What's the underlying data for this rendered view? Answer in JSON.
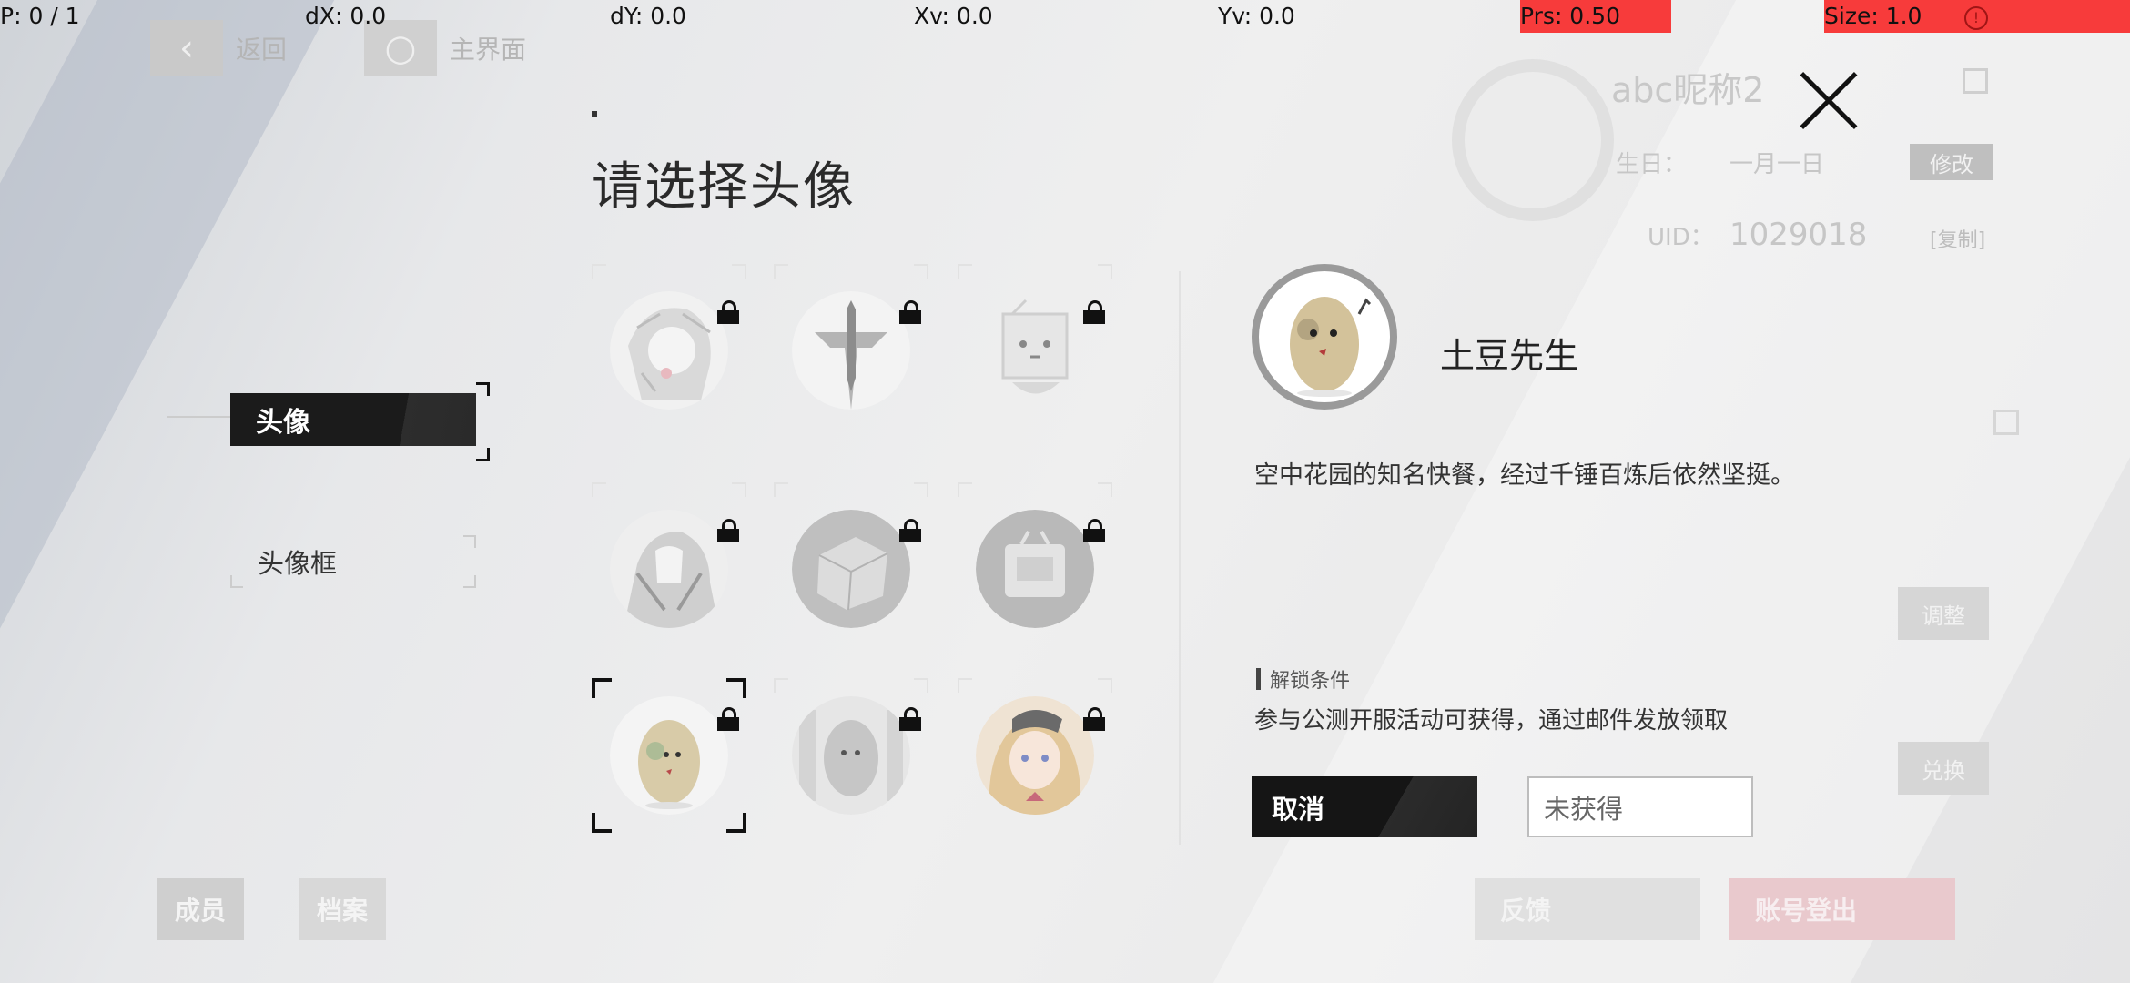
{
  "debug": {
    "pointer": "P: 0 / 1",
    "dx": "dX: 0.0",
    "dy": "dY: 0.0",
    "xv": "Xv: 0.0",
    "yv": "Yv: 0.0",
    "prs": "Prs: 0.50",
    "size": "Size: 1.0"
  },
  "background": {
    "back_label": "返回",
    "home_label": "主界面",
    "nickname": "abc昵称2",
    "birthday_label": "生日：",
    "birthday_value": "一月一日",
    "modify_label": "修改",
    "uid_label": "UID：",
    "uid_value": "1029018",
    "copy_label": "[复制]",
    "side_btn_1": "调整",
    "side_btn_2": "兑换",
    "bottom_left_1": "成员",
    "bottom_left_2": "档案",
    "bottom_right_1": "反馈",
    "bottom_right_2": "账号登出"
  },
  "tabs": [
    {
      "label": "头像",
      "active": true
    },
    {
      "label": "头像框",
      "active": false
    }
  ],
  "dialog": {
    "title": "请选择头像",
    "avatars": [
      {
        "icon": "girl-sketch-avatar",
        "locked": true
      },
      {
        "icon": "emblem-logo-avatar",
        "locked": true
      },
      {
        "icon": "tv-robot-avatar",
        "locked": true
      },
      {
        "icon": "hooded-girl-avatar",
        "locked": true
      },
      {
        "icon": "gray-cube-avatar",
        "locked": true
      },
      {
        "icon": "gray-tv-avatar",
        "locked": true
      },
      {
        "icon": "potato-avatar",
        "locked": true,
        "selected": true
      },
      {
        "icon": "gray-potato-avatar",
        "locked": true
      },
      {
        "icon": "blonde-girl-avatar",
        "locked": true
      }
    ],
    "detail": {
      "name": "土豆先生",
      "description": "空中花园的知名快餐，经过千锤百炼后依然坚挺。",
      "unlock_heading": "解锁条件",
      "unlock_text": "参与公测开服活动可获得，通过邮件发放领取",
      "cancel_label": "取消",
      "status_label": "未获得"
    }
  },
  "colors": {
    "accent_dark": "#151515",
    "debug_red": "#f73b3b"
  }
}
